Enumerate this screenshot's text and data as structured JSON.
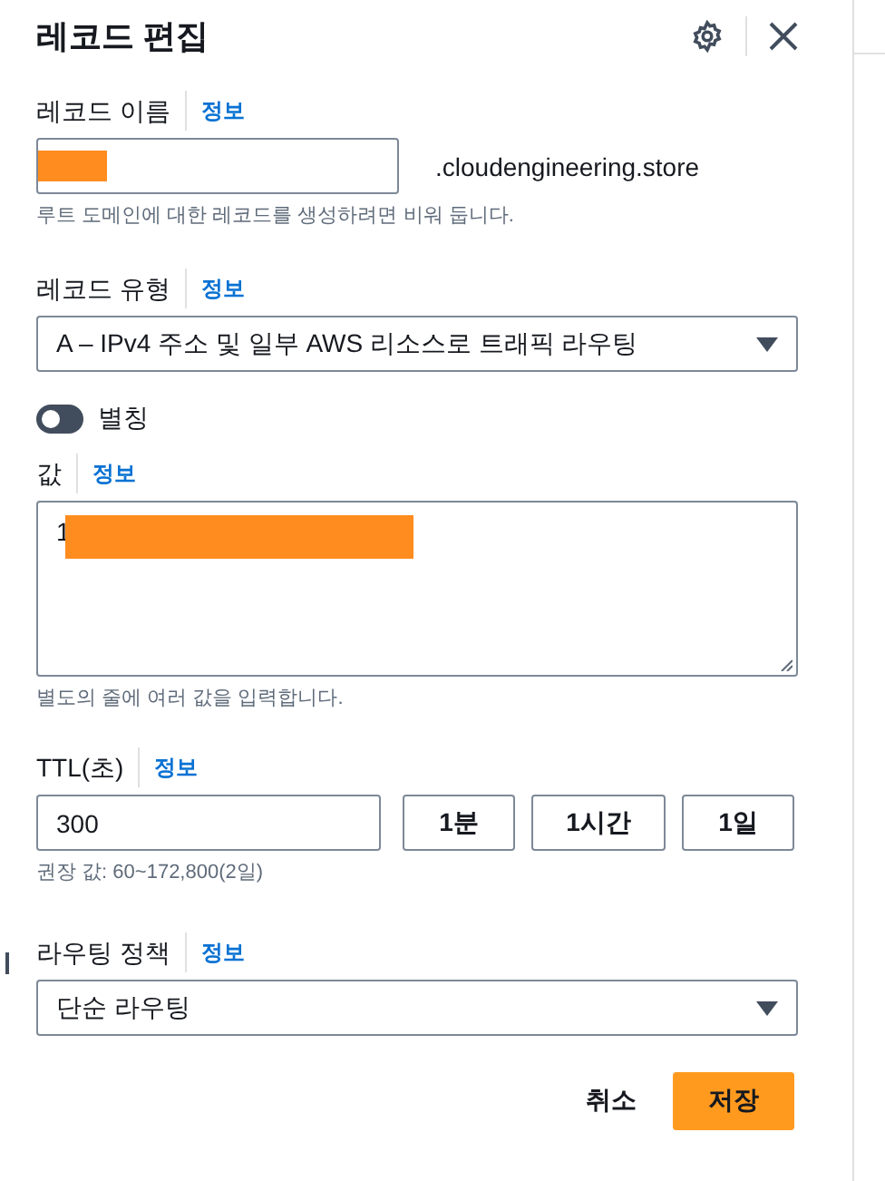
{
  "header": {
    "title": "레코드 편집"
  },
  "record_name": {
    "label": "레코드 이름",
    "info": "정보",
    "redacted": true,
    "suffix": ".cloudengineering.store",
    "hint": "루트 도메인에 대한 레코드를 생성하려면 비워 둡니다."
  },
  "record_type": {
    "label": "레코드 유형",
    "info": "정보",
    "value": "A – IPv4 주소 및 일부 AWS 리소스로 트래픽 라우팅"
  },
  "alias": {
    "label": "별칭",
    "on": false
  },
  "value": {
    "label": "값",
    "info": "정보",
    "value": "1",
    "redacted": true,
    "hint": "별도의 줄에 여러 값을 입력합니다."
  },
  "ttl": {
    "label": "TTL(초)",
    "info": "정보",
    "value": "300",
    "presets": [
      "1분",
      "1시간",
      "1일"
    ],
    "hint": "권장 값: 60~172,800(2일)"
  },
  "routing": {
    "label": "라우팅 정책",
    "info": "정보",
    "value": "단순 라우팅"
  },
  "actions": {
    "cancel": "취소",
    "save": "저장"
  }
}
